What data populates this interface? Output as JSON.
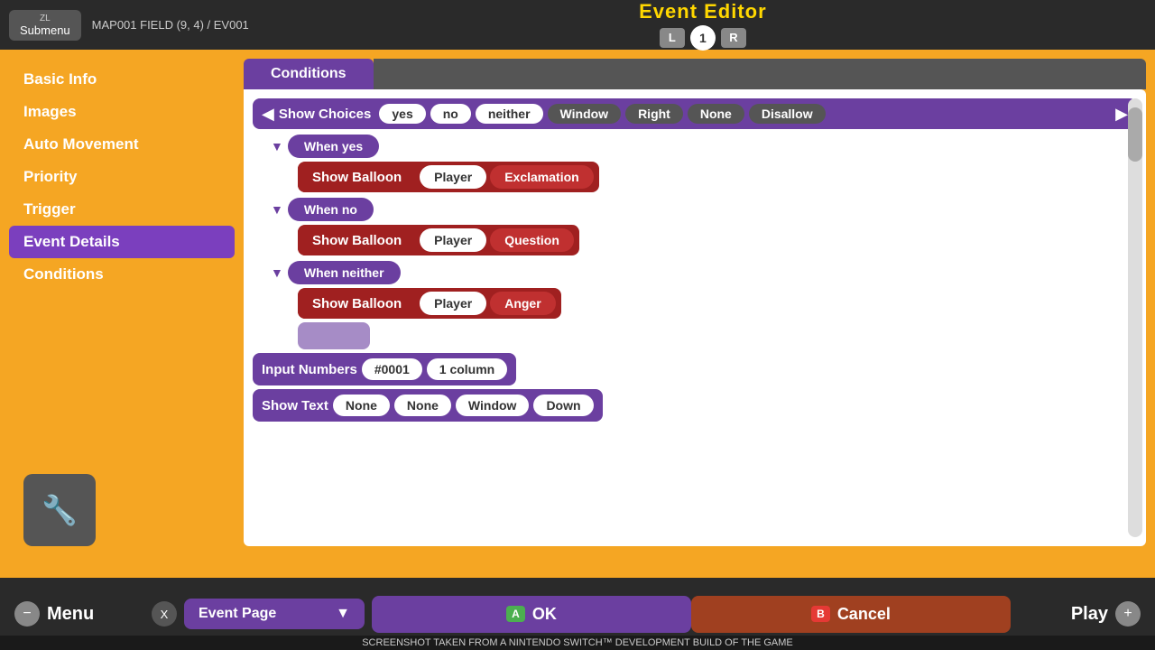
{
  "topbar": {
    "submenu_label": "Submenu",
    "zl_label": "ZL",
    "breadcrumb": "MAP001 FIELD (9, 4) / EV001",
    "title": "Event Editor",
    "page_left": "L",
    "page_num": "1",
    "page_right": "R"
  },
  "sidebar": {
    "items": [
      {
        "label": "Basic Info",
        "active": false
      },
      {
        "label": "Images",
        "active": false
      },
      {
        "label": "Auto Movement",
        "active": false
      },
      {
        "label": "Priority",
        "active": false
      },
      {
        "label": "Trigger",
        "active": false
      },
      {
        "label": "Event Details",
        "active": true
      },
      {
        "label": "Conditions",
        "active": false
      }
    ]
  },
  "tabs": {
    "conditions_tab": "Conditions"
  },
  "event": {
    "show_choices": "Show Choices",
    "choices": [
      "yes",
      "no",
      "neither",
      "Window",
      "Right",
      "None",
      "Disallow"
    ],
    "when_yes": "When yes",
    "balloon_yes": {
      "label": "Show Balloon",
      "target": "Player",
      "type": "Exclamation"
    },
    "when_no": "When no",
    "balloon_no": {
      "label": "Show Balloon",
      "target": "Player",
      "type": "Question"
    },
    "when_neither": "When neither",
    "balloon_neither": {
      "label": "Show Balloon",
      "target": "Player",
      "type": "Anger"
    },
    "input_numbers": "Input Numbers",
    "input_id": "#0001",
    "input_columns": "1 column",
    "show_text": "Show Text",
    "text_options": [
      "None",
      "None",
      "Window",
      "Down"
    ]
  },
  "bottom": {
    "menu_label": "Menu",
    "event_page_label": "Event Page",
    "ok_label": "OK",
    "cancel_label": "Cancel",
    "play_label": "Play",
    "notice": "SCREENSHOT TAKEN FROM A NINTENDO SWITCH™ DEVELOPMENT BUILD OF THE GAME",
    "a_badge": "A",
    "b_badge": "B",
    "x_badge": "X"
  }
}
